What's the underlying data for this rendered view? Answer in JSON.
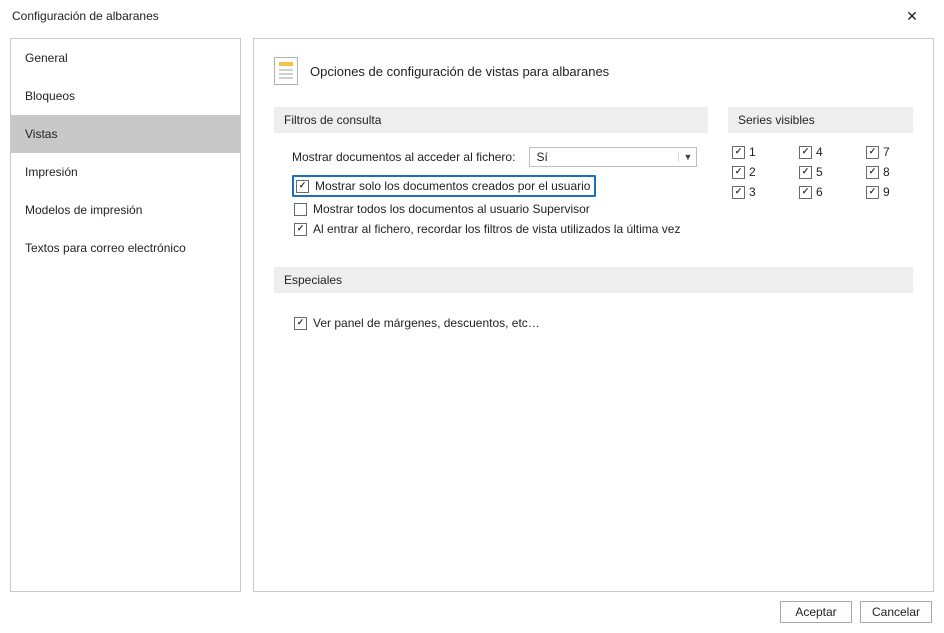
{
  "window": {
    "title": "Configuración de albaranes"
  },
  "nav": {
    "items": [
      {
        "label": "General"
      },
      {
        "label": "Bloqueos"
      },
      {
        "label": "Vistas"
      },
      {
        "label": "Impresión"
      },
      {
        "label": "Modelos de impresión"
      },
      {
        "label": "Textos para correo electrónico"
      }
    ],
    "selected_index": 2
  },
  "header": {
    "title": "Opciones de configuración de vistas para albaranes"
  },
  "filters": {
    "section_title": "Filtros de consulta",
    "show_docs_label": "Mostrar documentos al acceder al fichero:",
    "show_docs_value": "Sí",
    "chk_user_only": {
      "checked": true,
      "label": "Mostrar solo los documentos creados por el usuario"
    },
    "chk_supervisor": {
      "checked": false,
      "label": "Mostrar todos los documentos al usuario Supervisor"
    },
    "chk_remember": {
      "checked": true,
      "label": "Al entrar al fichero, recordar los filtros de vista utilizados la última vez"
    }
  },
  "series": {
    "section_title": "Series visibles",
    "items": [
      {
        "n": "1",
        "checked": true
      },
      {
        "n": "4",
        "checked": true
      },
      {
        "n": "7",
        "checked": true
      },
      {
        "n": "2",
        "checked": true
      },
      {
        "n": "5",
        "checked": true
      },
      {
        "n": "8",
        "checked": true
      },
      {
        "n": "3",
        "checked": true
      },
      {
        "n": "6",
        "checked": true
      },
      {
        "n": "9",
        "checked": true
      }
    ]
  },
  "specials": {
    "section_title": "Especiales",
    "chk_panel": {
      "checked": true,
      "label": "Ver panel de márgenes, descuentos, etc…"
    }
  },
  "footer": {
    "accept": "Aceptar",
    "cancel": "Cancelar"
  }
}
